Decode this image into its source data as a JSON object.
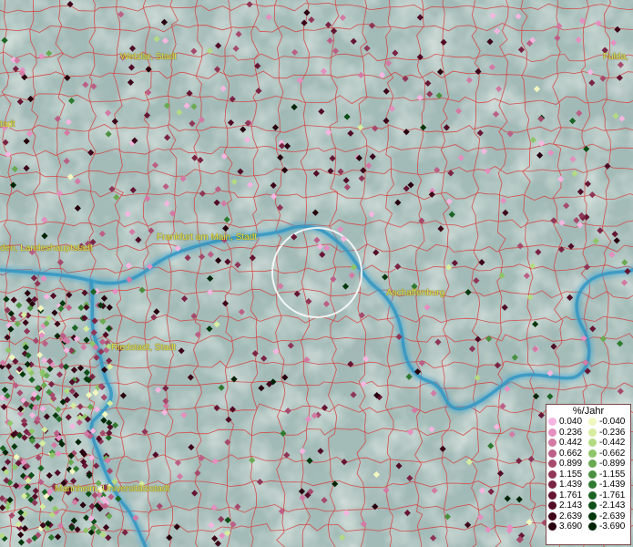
{
  "map": {
    "city_labels": [
      "Wetzlar, Stadt",
      "Fulda, ",
      "tadt",
      "Frankfurt am Main, Stadt",
      "den, Landeshauptstadt",
      "Aschaffenburg",
      "Riedstadt, Stadt",
      "Mannheim, Universitätsstadt"
    ],
    "colors": {
      "terrain": "#9fb8b4",
      "borders": "#d83a3a",
      "river": "#3aa0c8",
      "label": "#e8e24a",
      "selection_circle": "#ffffff"
    }
  },
  "legend": {
    "title": "%/Jahr",
    "positive": [
      {
        "value": "0.040",
        "color": "#f4b6e0"
      },
      {
        "value": "0.236",
        "color": "#e48fc0"
      },
      {
        "value": "0.442",
        "color": "#d27aa4"
      },
      {
        "value": "0.662",
        "color": "#bb5f86"
      },
      {
        "value": "0.899",
        "color": "#a64a6c"
      },
      {
        "value": "1.155",
        "color": "#8f3656"
      },
      {
        "value": "1.439",
        "color": "#7a2444"
      },
      {
        "value": "1.761",
        "color": "#661634"
      },
      {
        "value": "2.143",
        "color": "#520c26"
      },
      {
        "value": "2.639",
        "color": "#3e0619"
      },
      {
        "value": "3.690",
        "color": "#28020e"
      }
    ],
    "negative": [
      {
        "value": "-0.040",
        "color": "#f2f7c0"
      },
      {
        "value": "-0.236",
        "color": "#d6ec9e"
      },
      {
        "value": "-0.442",
        "color": "#b4db84"
      },
      {
        "value": "-0.662",
        "color": "#8fc56a"
      },
      {
        "value": "-0.899",
        "color": "#6aaa52"
      },
      {
        "value": "-1.155",
        "color": "#4a9040"
      },
      {
        "value": "-1.439",
        "color": "#2f7a30"
      },
      {
        "value": "-1.761",
        "color": "#1c6424"
      },
      {
        "value": "-2.143",
        "color": "#0e4e18"
      },
      {
        "value": "-2.639",
        "color": "#06380e"
      },
      {
        "value": "-3.690",
        "color": "#022406"
      }
    ]
  }
}
